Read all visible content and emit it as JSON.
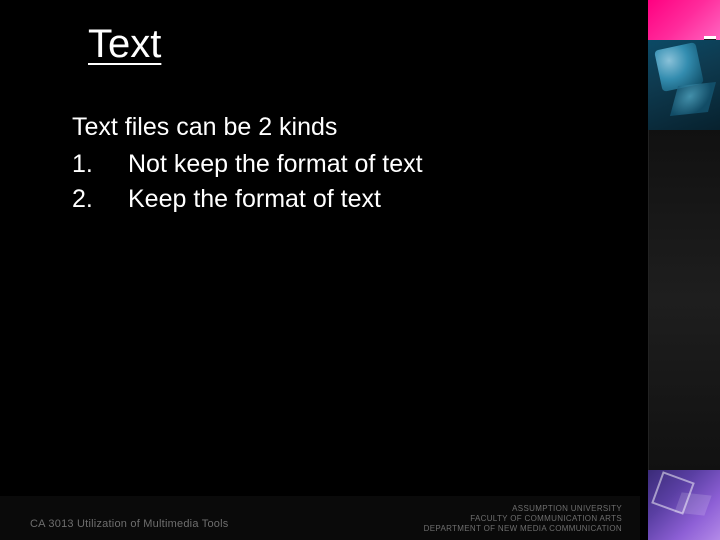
{
  "title": "Text",
  "body": {
    "intro": "Text files can be 2 kinds",
    "items": [
      {
        "num": "1.",
        "text": "Not keep the format of text"
      },
      {
        "num": "2.",
        "text": "Keep the format of text"
      }
    ]
  },
  "footer": {
    "left": "CA 3013 Utilization of Multimedia Tools",
    "right": {
      "line1": "ASSUMPTION UNIVERSITY",
      "line2": "FACULTY OF COMMUNICATION ARTS",
      "line3": "DEPARTMENT OF NEW MEDIA COMMUNICATION"
    }
  }
}
